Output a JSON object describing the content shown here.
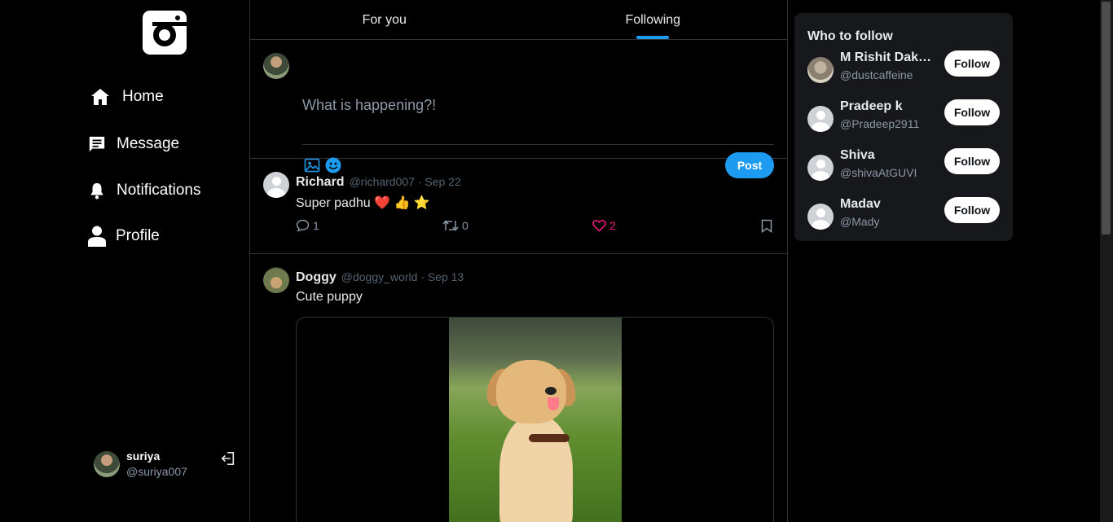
{
  "sidebar": {
    "logo": "camera-logo",
    "items": [
      {
        "label": "Home",
        "icon": "home-icon"
      },
      {
        "label": "Message",
        "icon": "message-icon"
      },
      {
        "label": "Notifications",
        "icon": "bell-icon"
      },
      {
        "label": "Profile",
        "icon": "user-icon"
      }
    ],
    "user": {
      "name": "suriya",
      "handle": "@suriya007"
    }
  },
  "feed": {
    "tabs": [
      {
        "label": "For you",
        "active": false
      },
      {
        "label": "Following",
        "active": true
      }
    ],
    "composer": {
      "placeholder": "What is happening?!",
      "post_label": "Post"
    },
    "tweets": [
      {
        "name": "Richard",
        "meta": "@richard007 · Sep 22",
        "text": "Super padhu ❤️ 👍 ⭐",
        "replies": "1",
        "retweets": "0",
        "likes": "2"
      },
      {
        "name": "Doggy",
        "meta": "@doggy_world · Sep 13",
        "text": "Cute puppy"
      }
    ]
  },
  "who_to_follow": {
    "title": "Who to follow",
    "button_label": "Follow",
    "users": [
      {
        "name": "M Rishit Daks...",
        "handle": "@dustcaffeine"
      },
      {
        "name": "Pradeep k",
        "handle": "@Pradeep2911"
      },
      {
        "name": "Shiva",
        "handle": "@shivaAtGUVI"
      },
      {
        "name": "Madav",
        "handle": "@Mady"
      }
    ]
  },
  "colors": {
    "accent": "#1d9bf0",
    "like": "#f91880",
    "bg": "#000000"
  }
}
